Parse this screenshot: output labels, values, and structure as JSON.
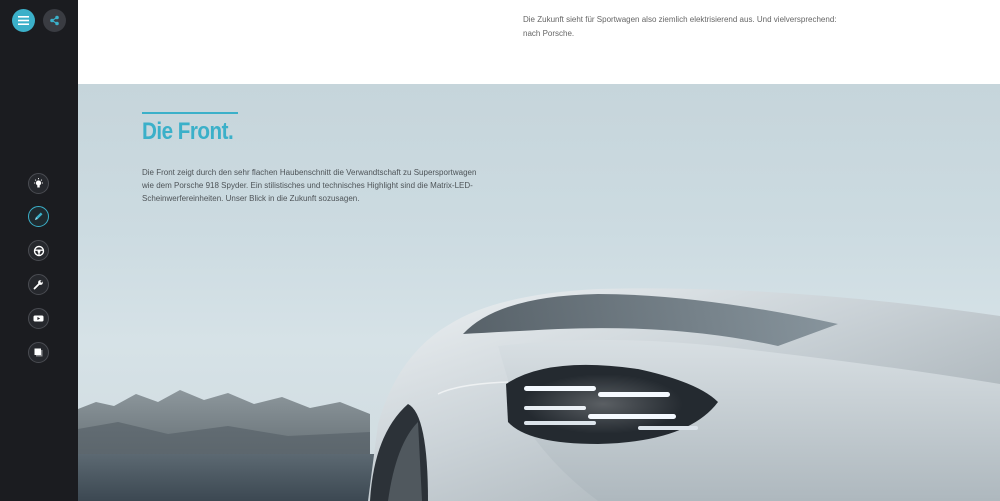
{
  "sidebar": {
    "menu_icon": "hamburger-menu-icon",
    "share_icon": "share-icon",
    "nav_items": [
      {
        "name": "lightbulb-icon",
        "active": false
      },
      {
        "name": "pen-icon",
        "active": true
      },
      {
        "name": "steering-wheel-icon",
        "active": false
      },
      {
        "name": "wrench-icon",
        "active": false
      },
      {
        "name": "video-play-icon",
        "active": false
      },
      {
        "name": "layers-icon",
        "active": false
      }
    ]
  },
  "intro": {
    "text": "Die Zukunft sieht für Sportwagen also ziemlich elektrisierend aus. Und vielversprechend: nach Porsche."
  },
  "front_section": {
    "title": "Die Front.",
    "description": "Die Front zeigt durch den sehr flachen Haubenschnitt die Verwandtschaft zu Supersportwagen wie dem Porsche 918 Spyder. Ein stilistisches und technisches Highlight sind die Matrix-LED-Scheinwerfereinheiten. Unser Blick in die Zukunft sozusagen."
  },
  "colors": {
    "accent": "#3bb0c9",
    "sidebar_bg": "#1b1c20"
  }
}
